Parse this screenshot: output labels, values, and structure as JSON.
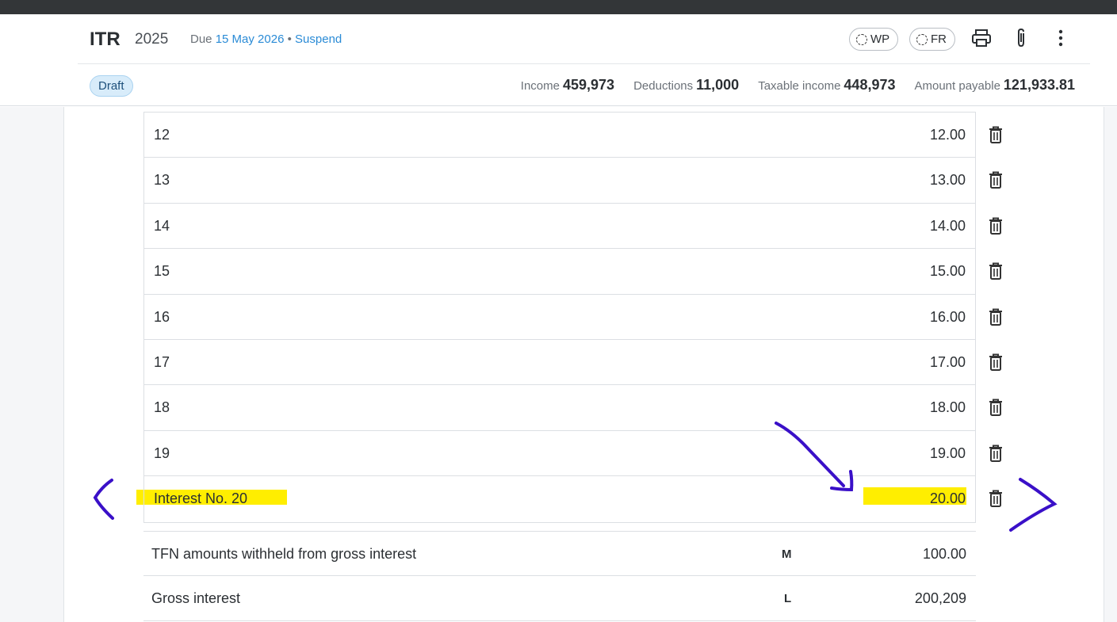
{
  "header": {
    "title": "ITR",
    "year": "2025",
    "due_prefix": "Due",
    "due_date": "15 May 2026",
    "separator": "•",
    "suspend_label": "Suspend",
    "pills": [
      "WP",
      "FR"
    ],
    "status_badge": "Draft",
    "stats": [
      {
        "label": "Income",
        "value": "459,973"
      },
      {
        "label": "Deductions",
        "value": "11,000"
      },
      {
        "label": "Taxable income",
        "value": "448,973"
      },
      {
        "label": "Amount payable",
        "value": "121,933.81"
      }
    ],
    "icons": [
      "print-icon",
      "paperclip-icon",
      "more-vertical-icon"
    ]
  },
  "interest_rows": [
    {
      "label": "12",
      "value": "12.00"
    },
    {
      "label": "13",
      "value": "13.00"
    },
    {
      "label": "14",
      "value": "14.00"
    },
    {
      "label": "15",
      "value": "15.00"
    },
    {
      "label": "16",
      "value": "16.00"
    },
    {
      "label": "17",
      "value": "17.00"
    },
    {
      "label": "18",
      "value": "18.00"
    },
    {
      "label": "19",
      "value": "19.00"
    },
    {
      "label": "Interest No. 20",
      "value": "20.00"
    }
  ],
  "summary_rows": [
    {
      "label": "TFN amounts withheld from gross interest",
      "code": "M",
      "value": "100.00"
    },
    {
      "label": "Gross interest",
      "code": "L",
      "value": "200,209"
    }
  ],
  "colors": {
    "accent": "#2a8bd6",
    "highlight": "#ffee00",
    "ink": "#3a10c8",
    "badge_bg": "#d8ecfa"
  }
}
